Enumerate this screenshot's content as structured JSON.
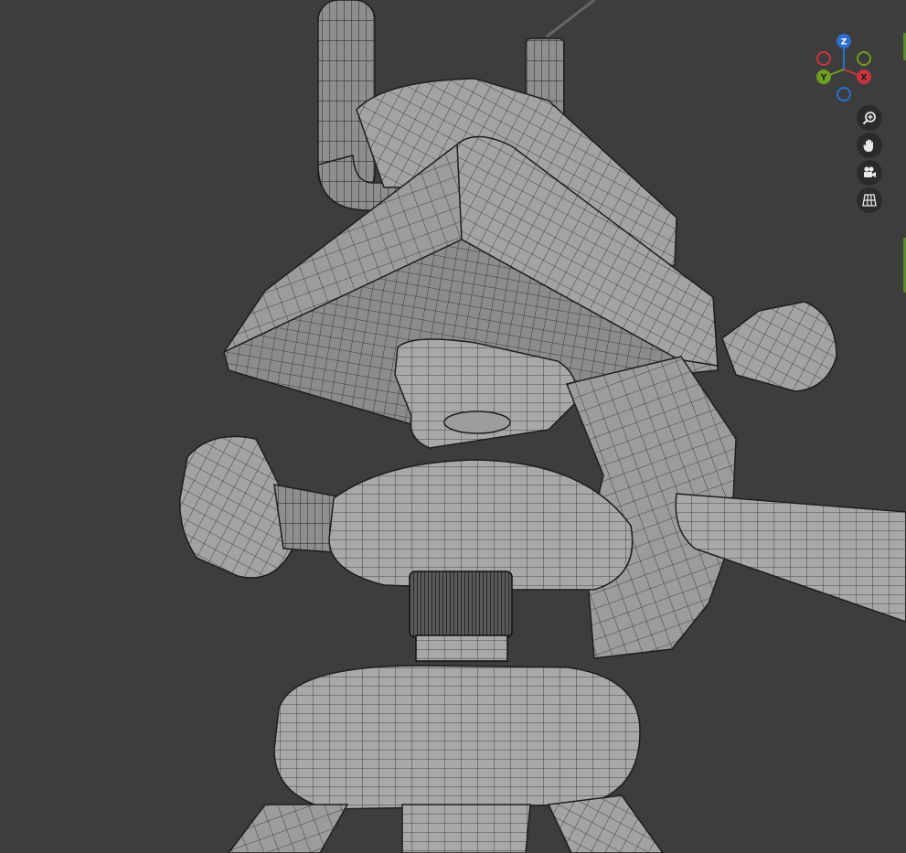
{
  "app": {
    "context": "3d-viewport",
    "shading": "wireframe-overlay"
  },
  "gizmo": {
    "axes": [
      {
        "label": "Z",
        "color": "#2c6fcf"
      },
      {
        "label": "Y",
        "color": "#6e9f1f"
      },
      {
        "label": "X",
        "color": "#c8343f"
      }
    ],
    "negative_colors": {
      "x": "#c8343f",
      "y": "#6e9f1f",
      "z": "#2c6fcf"
    }
  },
  "navigation": [
    {
      "name": "zoom",
      "icon": "magnifier-plus-icon"
    },
    {
      "name": "pan",
      "icon": "hand-icon"
    },
    {
      "name": "camera-view",
      "icon": "camera-icon"
    },
    {
      "name": "orthographic-toggle",
      "icon": "grid-icon"
    }
  ],
  "colors": {
    "background": "#3d3d3d",
    "model_fill": "#9a9a9a",
    "wire": "#222222",
    "button_bg": "#2b2b2b"
  }
}
